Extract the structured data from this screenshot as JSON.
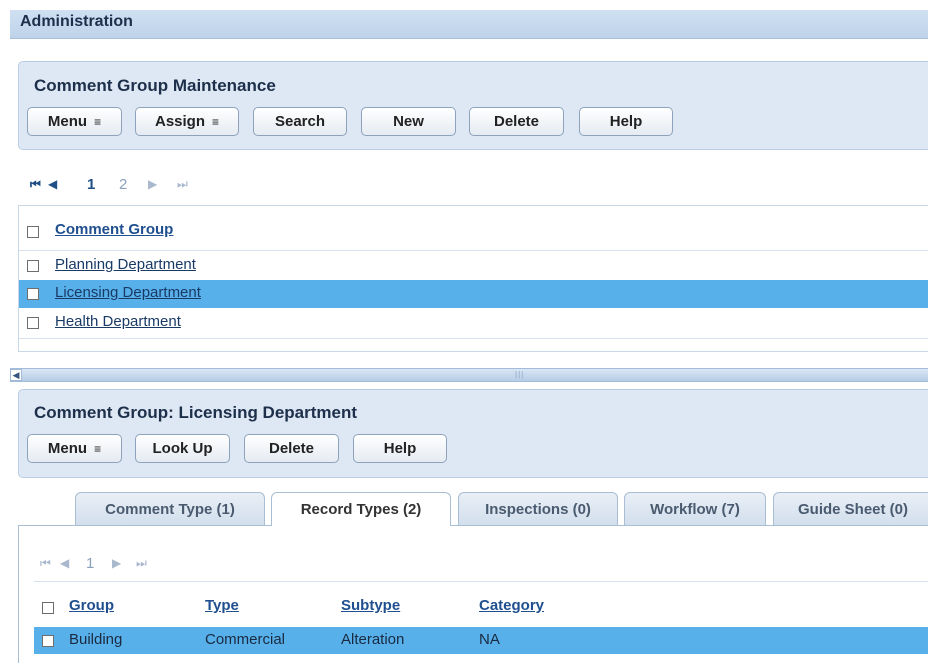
{
  "header": {
    "title": "Administration"
  },
  "maintenance": {
    "title": "Comment Group Maintenance",
    "buttons": {
      "menu": "Menu",
      "assign": "Assign",
      "search": "Search",
      "new": "New",
      "delete": "Delete",
      "help": "Help"
    }
  },
  "list_pager": {
    "first": "⏮",
    "prev": "◀",
    "pages": [
      "1",
      "2"
    ],
    "current_page": "1",
    "next": "▶",
    "last": "⏭"
  },
  "list": {
    "column_header": "Comment Group",
    "rows": [
      {
        "label": "Planning Department",
        "selected": false
      },
      {
        "label": "Licensing Department",
        "selected": true
      },
      {
        "label": "Health Department",
        "selected": false
      }
    ]
  },
  "detail": {
    "title": "Comment Group: Licensing Department",
    "buttons": {
      "menu": "Menu",
      "lookup": "Look Up",
      "delete": "Delete",
      "help": "Help"
    },
    "tabs": [
      {
        "label": "Comment Type (1)",
        "active": false
      },
      {
        "label": "Record Types (2)",
        "active": true
      },
      {
        "label": "Inspections (0)",
        "active": false
      },
      {
        "label": "Workflow (7)",
        "active": false
      },
      {
        "label": "Guide Sheet (0)",
        "active": false
      }
    ],
    "pager": {
      "current_page": "1"
    },
    "table": {
      "columns": [
        "Group",
        "Type",
        "Subtype",
        "Category"
      ],
      "rows": [
        {
          "group": "Building",
          "type": "Commercial",
          "subtype": "Alteration",
          "category": "NA",
          "selected": true
        }
      ]
    }
  },
  "icons": {
    "menu_caret": "⩡",
    "splitter_left": "◀",
    "splitter_grip": "|||"
  },
  "colors": {
    "selected_row": "#57b0ea",
    "panel_bg": "#dde8f4",
    "link": "#1f4f8f"
  }
}
